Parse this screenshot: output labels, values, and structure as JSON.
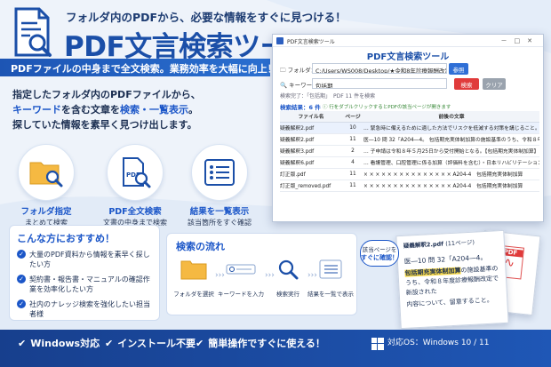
{
  "header": {
    "tagline": "フォルダ内のPDFから、必要な情報をすぐに見つける！",
    "title": "PDF文言検索ツール",
    "banner": "PDFファイルの中身まで全文検索。業務効率を大幅に向上！"
  },
  "description": {
    "line1": "指定したフォルダ内のPDFファイルから、",
    "line2a": "キーワード",
    "line2b": "を含む文章を",
    "line2c": "検索・一覧表示",
    "line2d": "。",
    "line3": "探していた情報を素早く見つけ出します。"
  },
  "features": [
    {
      "title": "フォルダ指定",
      "sub": "まとめて検索",
      "icon": "folder-search-icon"
    },
    {
      "title": "PDF全文検索",
      "sub": "文書の中身まで検索",
      "icon": "pdf-search-icon"
    },
    {
      "title": "結果を一覧表示",
      "sub": "該当箇所をすぐ確認",
      "icon": "list-icon"
    }
  ],
  "recommend": {
    "title": "こんな方におすすめ！",
    "items": [
      "大量のPDF資料から情報を素早く探したい方",
      "契約書・報告書・マニュアルの確認作業を効率化したい方",
      "社内のナレッジ検索を強化したい担当者様"
    ]
  },
  "flow": {
    "title": "検索の流れ",
    "steps": [
      "フォルダを選択",
      "キーワードを入力",
      "検索実行",
      "結果を一覧で表示"
    ]
  },
  "app": {
    "window_title": "PDF文言検索ツール",
    "heading": "PDF文言検索ツール",
    "folder_label": "フォルダ：",
    "folder_value": "C:/Users/WS008/Desktop/★令和8年診療報酬改定/疑義解釈",
    "browse_label": "参照",
    "keyword_label": "キーワード：",
    "keyword_value": "包括期",
    "search_label": "検索",
    "clear_label": "クリア",
    "status": "検索完了：「包括期」　PDF 11 件を検索",
    "result_count": "検索結果：6 件",
    "hint": "行をダブルクリックするとPDFの該当ページが開きます",
    "columns": [
      "ファイル名",
      "ページ",
      "前後の文章"
    ],
    "rows": [
      {
        "file": "疑義解釈2.pdf",
        "page": "10",
        "text": "… 緊急時に備えるために適した方法でリスクを低減する対策を講じること。【包括期充実体制加算】"
      },
      {
        "file": "疑義解釈2.pdf",
        "page": "11",
        "text": "医―10 問 32「A204―4。 包括期充実体制加算の施設基準のうち、令和８年度診療報酬改定で新設された"
      },
      {
        "file": "疑義解釈3.pdf",
        "page": "2",
        "text": "… 子申請は令和８年５月25日から受付開始となる。【包括期充実体制加算】 問３"
      },
      {
        "file": "疑義解釈6.pdf",
        "page": "4",
        "text": "… 看護管理、口腔管理に係る加算（評価料を含む）・日本リハビリテーション病院 包括期充実体制加算"
      },
      {
        "file": "訂正版.pdf",
        "page": "11",
        "text": "× × × × × × × × × × × × × × × A204-4　包括期充実体制加算"
      },
      {
        "file": "訂正版_removed.pdf",
        "page": "11",
        "text": "× × × × × × × × × × × × × × × A204-4　包括期充実体制加算"
      }
    ]
  },
  "preview": {
    "callout_line1": "該当ページを",
    "callout_line2": "すぐに確認！",
    "doc_title": "疑義解釈2.pdf",
    "doc_page": "(11ページ)",
    "doc_line1": "医―10 問 32「A204―4。",
    "doc_highlight": "包括期充実体制加算",
    "doc_line2b": "の施設基準のうち、令和８年度診療報酬改定で新設された",
    "doc_line3": "内容について、留意すること。",
    "pdf_badge": "PDF"
  },
  "footer": {
    "items": [
      "Windows対応",
      "インストール不要",
      "簡単操作ですぐに使える！"
    ],
    "os": "対応OS：Windows 10 / 11"
  },
  "colors": {
    "brand": "#1b56c8",
    "dark": "#173f8d",
    "search": "#e03b3b",
    "browse": "#2f6fd6"
  }
}
